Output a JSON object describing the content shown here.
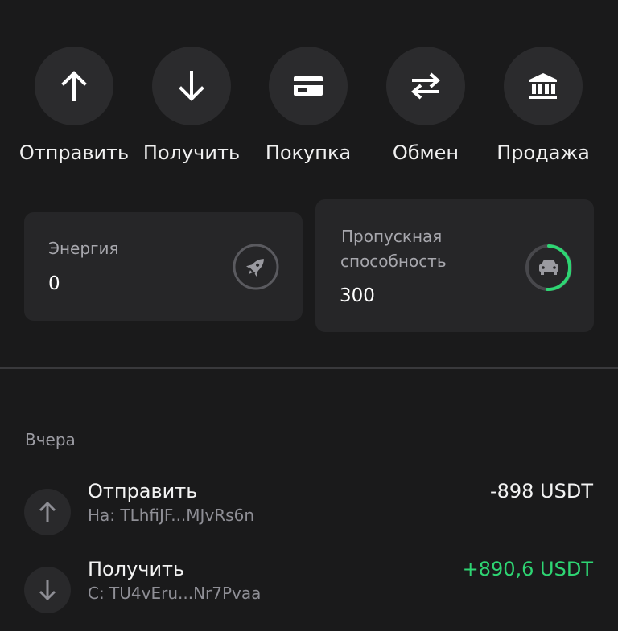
{
  "actions": [
    {
      "label": "Отправить",
      "icon": "arrow-up-icon"
    },
    {
      "label": "Получить",
      "icon": "arrow-down-icon"
    },
    {
      "label": "Покупка",
      "icon": "card-icon"
    },
    {
      "label": "Обмен",
      "icon": "swap-arrows-icon"
    },
    {
      "label": "Продажа",
      "icon": "bank-icon"
    }
  ],
  "resources": {
    "energy": {
      "title": "Энергия",
      "value": "0",
      "icon": "rocket-icon"
    },
    "bandwidth": {
      "title_line1": "Пропускная",
      "title_line2": "способность",
      "value": "300",
      "icon": "car-icon",
      "ring_color": "#2ed573"
    }
  },
  "history": {
    "section": "Вчера",
    "items": [
      {
        "title": "Отправить",
        "sub": "На: TLhfiJF...MJvRs6n",
        "amount": "-898 USDT",
        "amount_color": "#f3f3f3",
        "icon": "arrow-up-icon"
      },
      {
        "title": "Получить",
        "sub": "С: TU4vEru...Nr7Pvaa",
        "amount": "+890,6 USDT",
        "amount_color": "#2ed573",
        "icon": "arrow-down-icon"
      }
    ]
  }
}
